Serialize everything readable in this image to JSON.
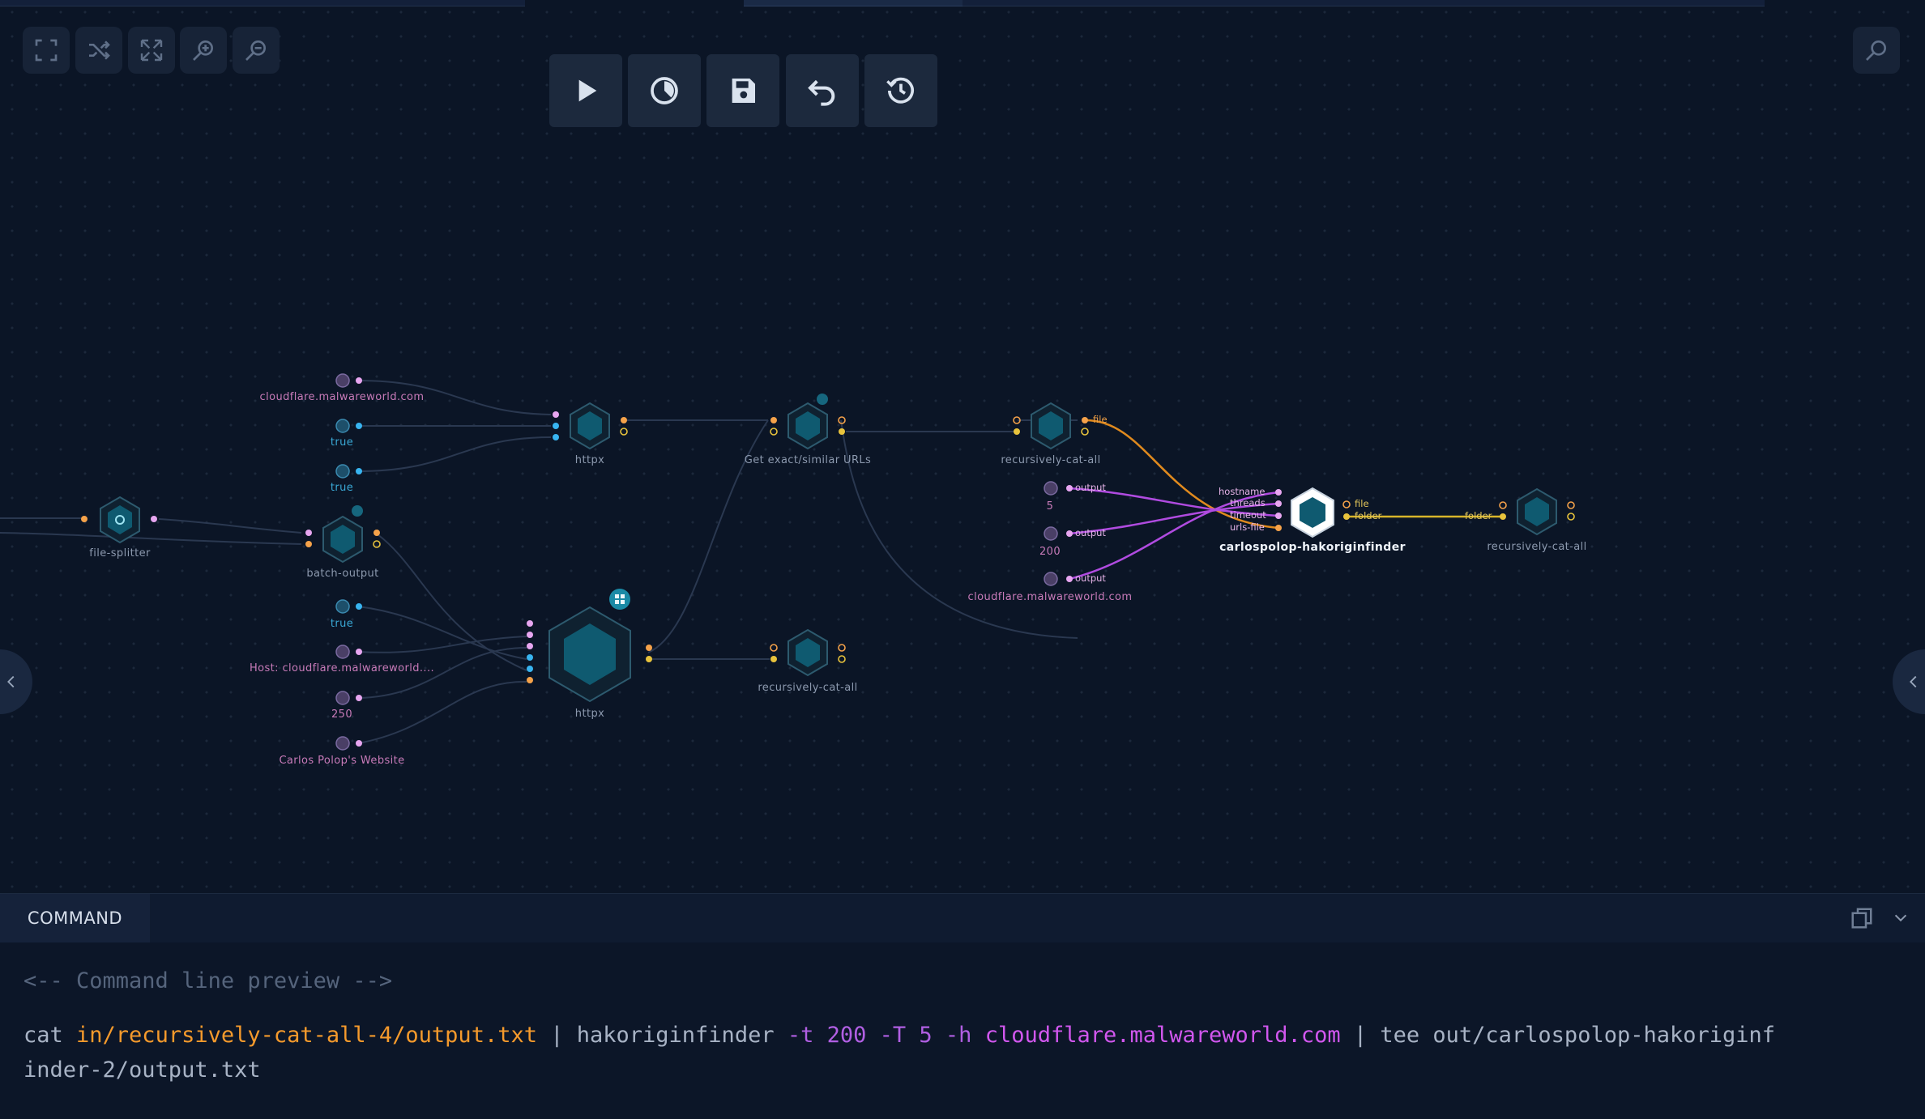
{
  "colors": {
    "background": "#0b1526",
    "node_fill": "#0f5a70",
    "port_pink": "#e7a6f0",
    "port_blue": "#38b4f0",
    "port_orange": "#f5a24a",
    "port_yellow": "#e8c33c",
    "edge_purple": "#b04be0",
    "edge_orange": "#e08a1e",
    "edge_yellow": "#d8b52a"
  },
  "view_controls": [
    {
      "name": "fit-view-icon"
    },
    {
      "name": "shuffle-icon"
    },
    {
      "name": "expand-icon"
    },
    {
      "name": "zoom-in-icon"
    },
    {
      "name": "zoom-out-icon"
    }
  ],
  "toolbar": [
    {
      "name": "play-icon"
    },
    {
      "name": "schedule-icon"
    },
    {
      "name": "save-icon"
    },
    {
      "name": "undo-icon"
    },
    {
      "name": "history-icon"
    }
  ],
  "nodes": {
    "file_splitter": "file-splitter",
    "batch_output": "batch-output",
    "httpx_top": "httpx",
    "get_urls": "Get exact/similar URLs",
    "cat_top": "recursively-cat-all",
    "hakoriginfinder": "carlospolop-hakoriginfinder",
    "cat_right": "recursively-cat-all",
    "httpx_big": "httpx",
    "cat_bottom": "recursively-cat-all"
  },
  "inputs": {
    "cf1": "cloudflare.malwareworld.com",
    "true1": "true",
    "true2": "true",
    "true3": "true",
    "host": "Host: cloudflare.malwareworld....",
    "v250": "250",
    "carlos": "Carlos Polop's Website",
    "v5": "5",
    "v200": "200",
    "cf2": "cloudflare.malwareworld.com"
  },
  "port_labels": {
    "file": "file",
    "output": "output",
    "hostname": "hostname",
    "threads": "threads",
    "timeout": "timeout",
    "urls_file": "urls-file",
    "out_file": "file",
    "out_folder": "folder",
    "in_folder": "folder"
  },
  "command_panel": {
    "tab": "COMMAND",
    "preview": "<-- Command line preview -->",
    "parts": {
      "p1": "cat ",
      "p2": "in/recursively-cat-all-4/output.txt",
      "p3": " | hakoriginfinder ",
      "p4": "-t 200 -T 5 -h ",
      "p5": "cloudflare.malwareworld.com",
      "p6": " | tee out/carlospolop-hakoriginf",
      "p7": "inder-2/output.txt"
    }
  }
}
